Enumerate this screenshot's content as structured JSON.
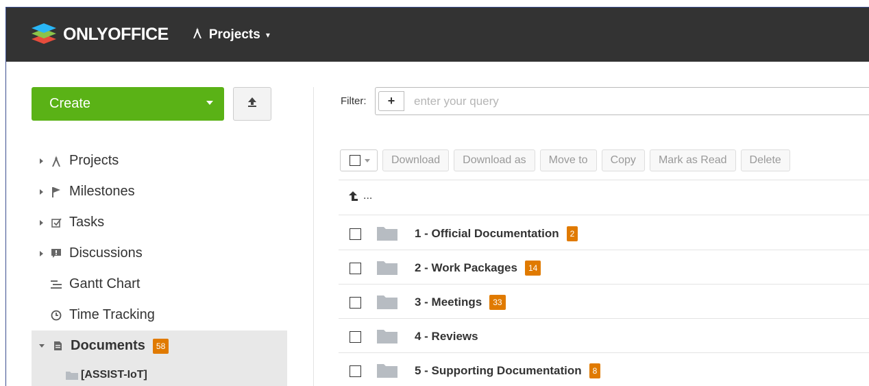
{
  "header": {
    "logo_text": "ONLYOFFICE",
    "module_label": "Projects"
  },
  "sidebar": {
    "create_label": "Create",
    "items": [
      {
        "label": "Projects",
        "icon": "compass-icon",
        "expandable": true
      },
      {
        "label": "Milestones",
        "icon": "flag-icon",
        "expandable": true
      },
      {
        "label": "Tasks",
        "icon": "task-check-icon",
        "expandable": true
      },
      {
        "label": "Discussions",
        "icon": "discussion-icon",
        "expandable": true
      },
      {
        "label": "Gantt Chart",
        "icon": "gantt-icon",
        "expandable": false
      },
      {
        "label": "Time Tracking",
        "icon": "clock-icon",
        "expandable": false
      },
      {
        "label": "Documents",
        "icon": "document-icon",
        "expandable": true,
        "expanded": true,
        "badge": "58"
      }
    ],
    "sub_items": [
      {
        "label": "[ASSIST-IoT]"
      }
    ]
  },
  "filter": {
    "label": "Filter:",
    "placeholder": "enter your query"
  },
  "toolbar": {
    "buttons": [
      "Download",
      "Download as",
      "Move to",
      "Copy",
      "Mark as Read",
      "Delete"
    ]
  },
  "list": {
    "up_label": "...",
    "folders": [
      {
        "name": "1 - Official Documentation",
        "badge": "2"
      },
      {
        "name": "2 - Work Packages",
        "badge": "14"
      },
      {
        "name": "3 - Meetings",
        "badge": "33"
      },
      {
        "name": "4 - Reviews",
        "badge": ""
      },
      {
        "name": "5 - Supporting Documentation",
        "badge": "8"
      }
    ]
  },
  "colors": {
    "topbar": "#333333",
    "create": "#5ab216",
    "badge": "#e07a00",
    "folder": "#b7bcc2"
  }
}
